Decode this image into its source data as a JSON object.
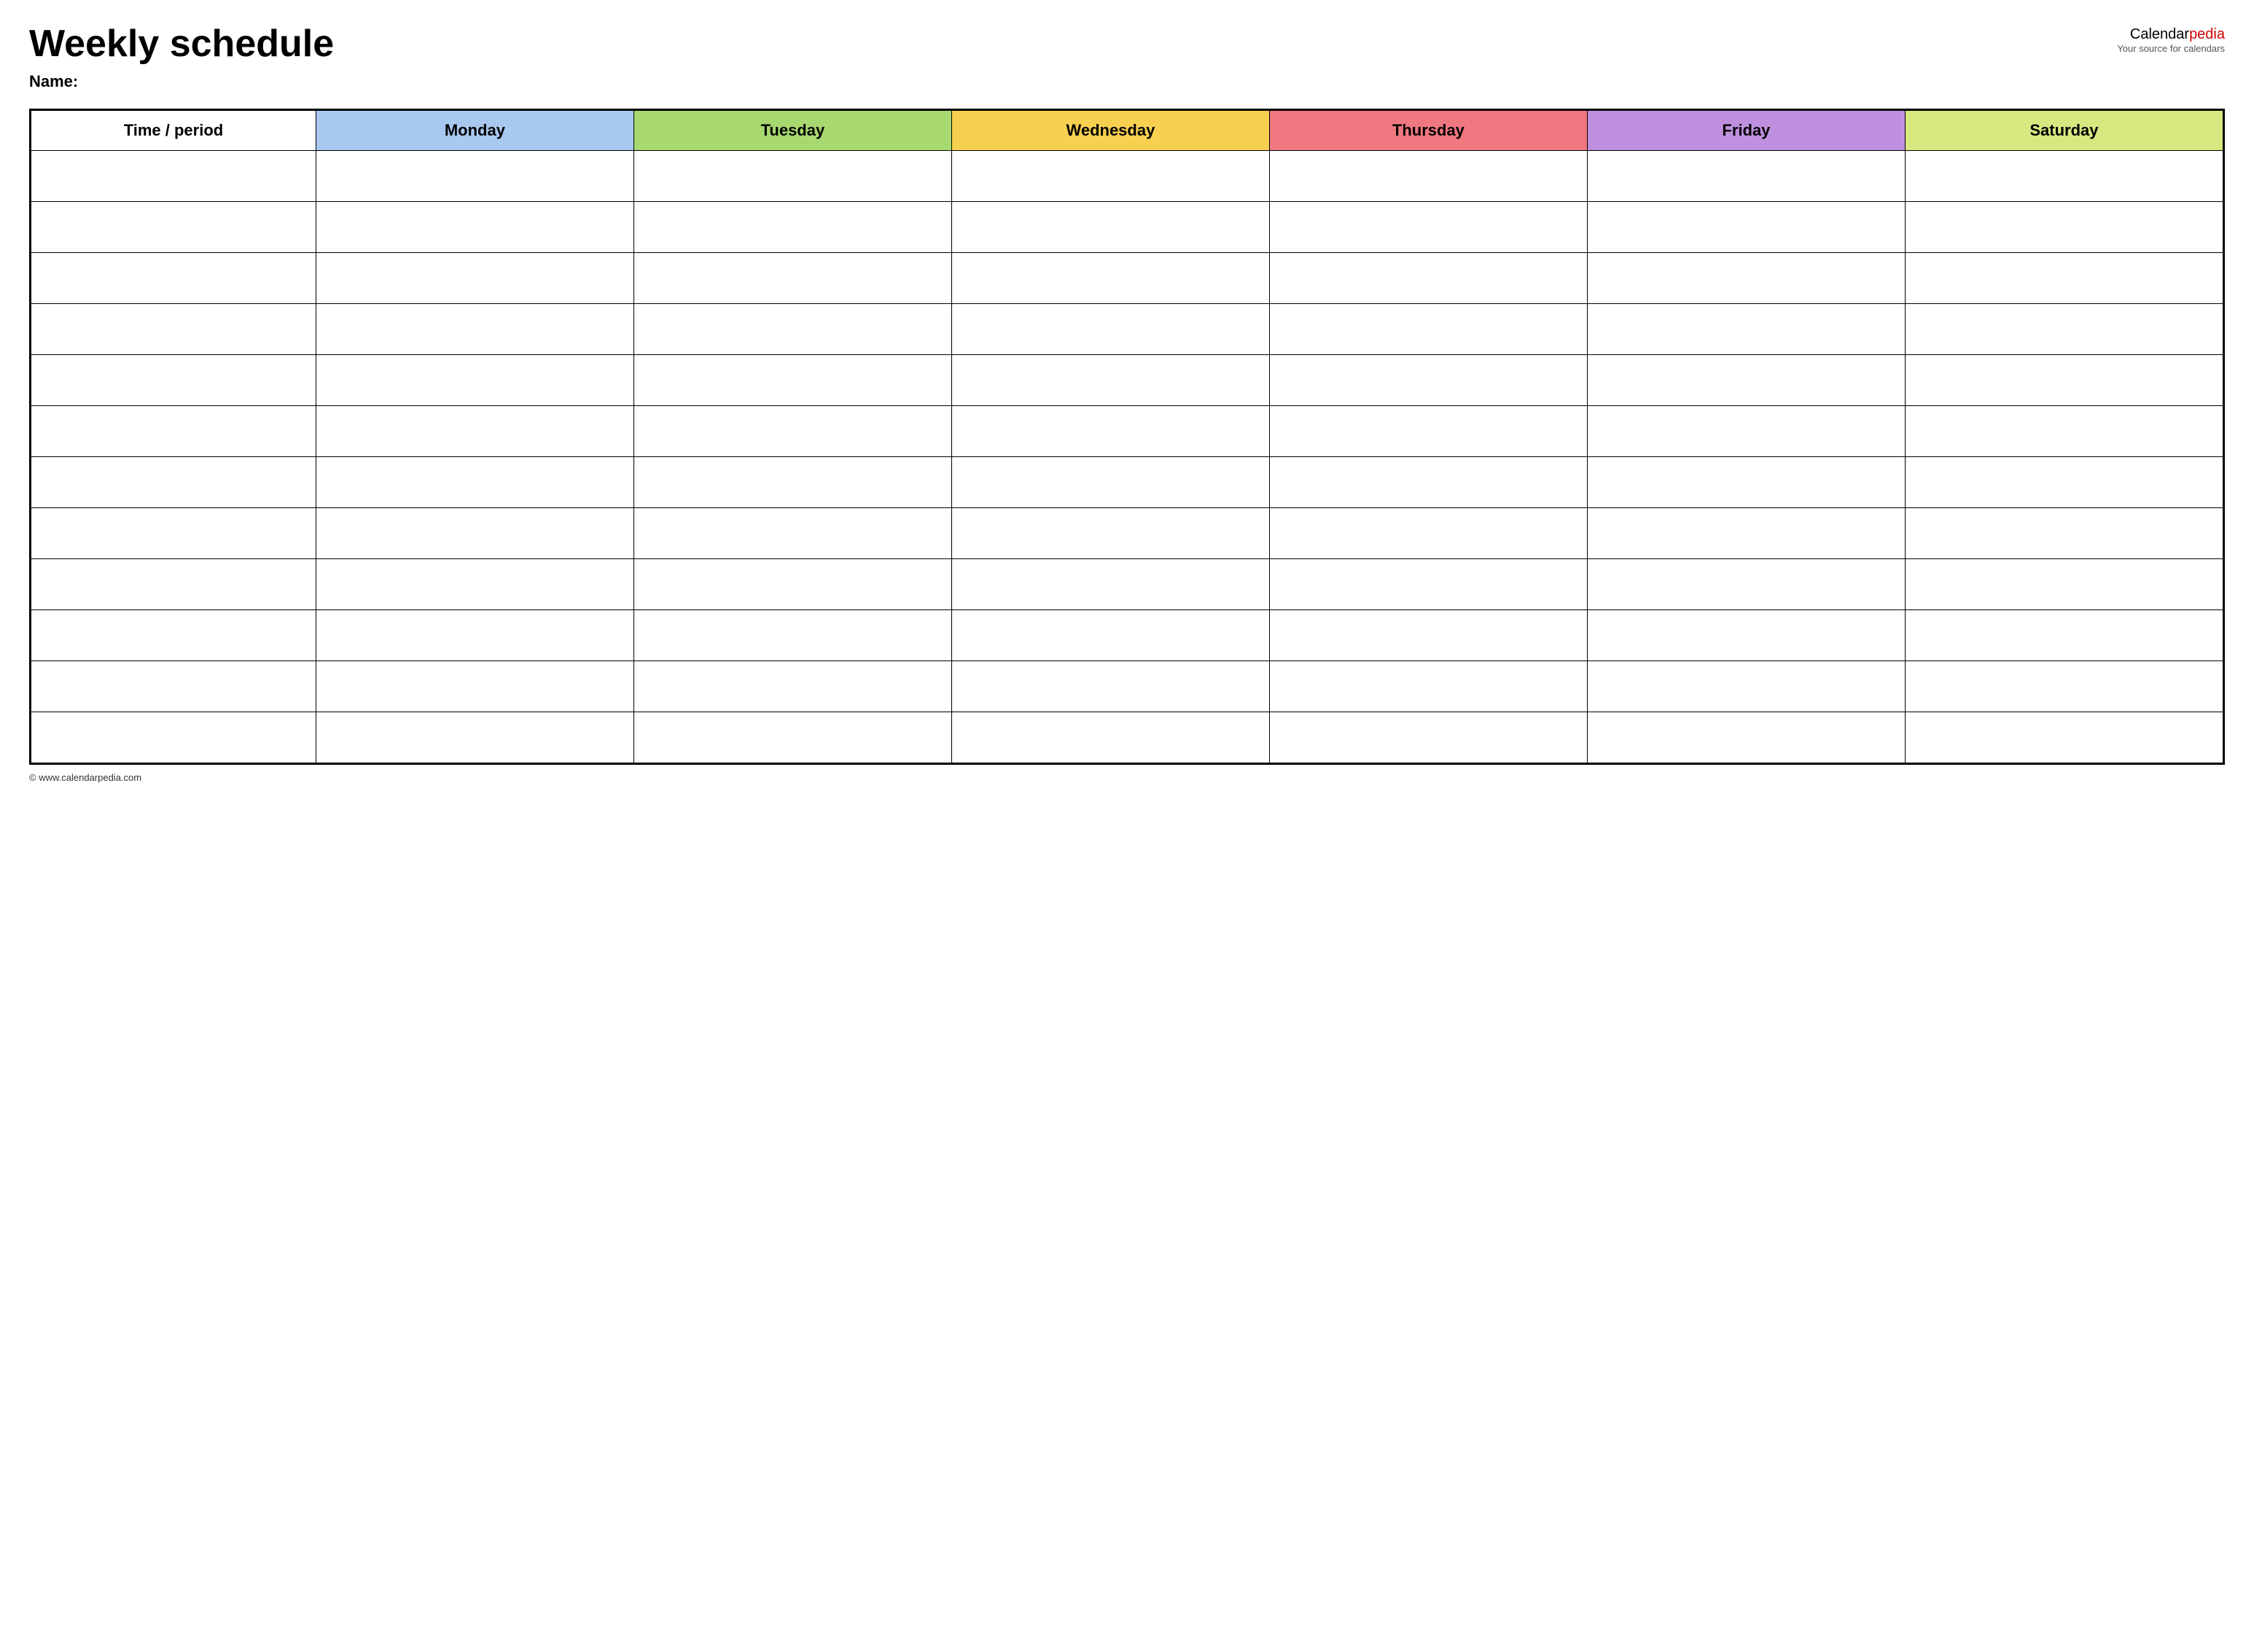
{
  "header": {
    "title": "Weekly schedule",
    "name_label": "Name:",
    "logo_calendar": "Calendar",
    "logo_pedia": "pedia",
    "logo_tagline": "Your source for calendars"
  },
  "table": {
    "columns": [
      {
        "key": "time",
        "label": "Time / period",
        "color_class": "col-time"
      },
      {
        "key": "monday",
        "label": "Monday",
        "color_class": "col-monday"
      },
      {
        "key": "tuesday",
        "label": "Tuesday",
        "color_class": "col-tuesday"
      },
      {
        "key": "wednesday",
        "label": "Wednesday",
        "color_class": "col-wednesday"
      },
      {
        "key": "thursday",
        "label": "Thursday",
        "color_class": "col-thursday"
      },
      {
        "key": "friday",
        "label": "Friday",
        "color_class": "col-friday"
      },
      {
        "key": "saturday",
        "label": "Saturday",
        "color_class": "col-saturday"
      }
    ],
    "row_count": 12
  },
  "footer": {
    "url": "© www.calendarpedia.com"
  }
}
